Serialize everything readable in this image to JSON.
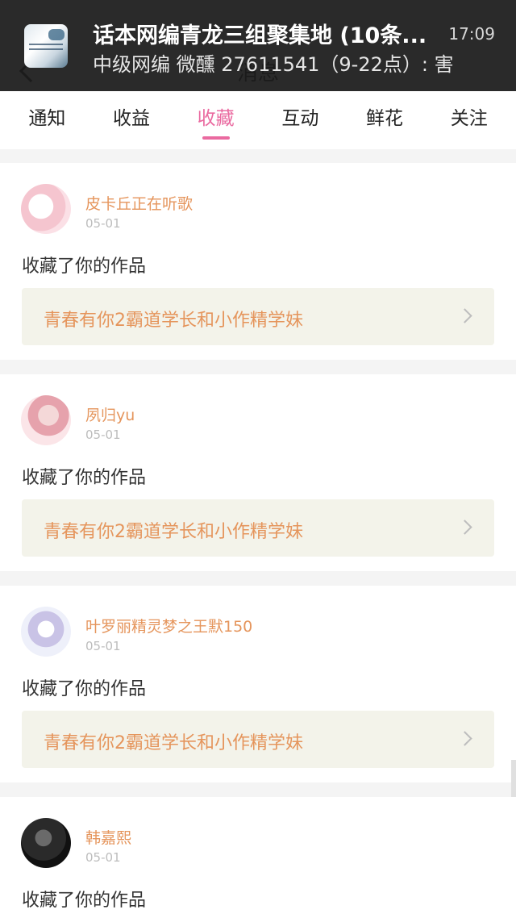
{
  "app": {
    "title": "消息"
  },
  "notification": {
    "title": "话本网编青龙三组聚集地 (10条...",
    "time": "17:09",
    "body": "中级网编 微醺 27611541（9-22点）: 害"
  },
  "tabs": [
    {
      "label": "通知"
    },
    {
      "label": "收益"
    },
    {
      "label": "收藏"
    },
    {
      "label": "互动"
    },
    {
      "label": "鲜花"
    },
    {
      "label": "关注"
    }
  ],
  "active_tab": "收藏",
  "feed": [
    {
      "user": "皮卡丘正在听歌",
      "date": "05-01",
      "action": "收藏了你的作品",
      "work": "青春有你2霸道学长和小作精学妹"
    },
    {
      "user": "夙归yu",
      "date": "05-01",
      "action": "收藏了你的作品",
      "work": "青春有你2霸道学长和小作精学妹"
    },
    {
      "user": "叶罗丽精灵梦之王默150",
      "date": "05-01",
      "action": "收藏了你的作品",
      "work": "青春有你2霸道学长和小作精学妹"
    },
    {
      "user": "韩嘉熙",
      "date": "05-01",
      "action": "收藏了你的作品"
    }
  ],
  "icons": {
    "back": "back-arrow-icon",
    "chevron": "chevron-right-icon"
  },
  "colors": {
    "accent": "#ea6aa0",
    "username": "#e5955c",
    "work_bg": "#f3f3ea"
  }
}
